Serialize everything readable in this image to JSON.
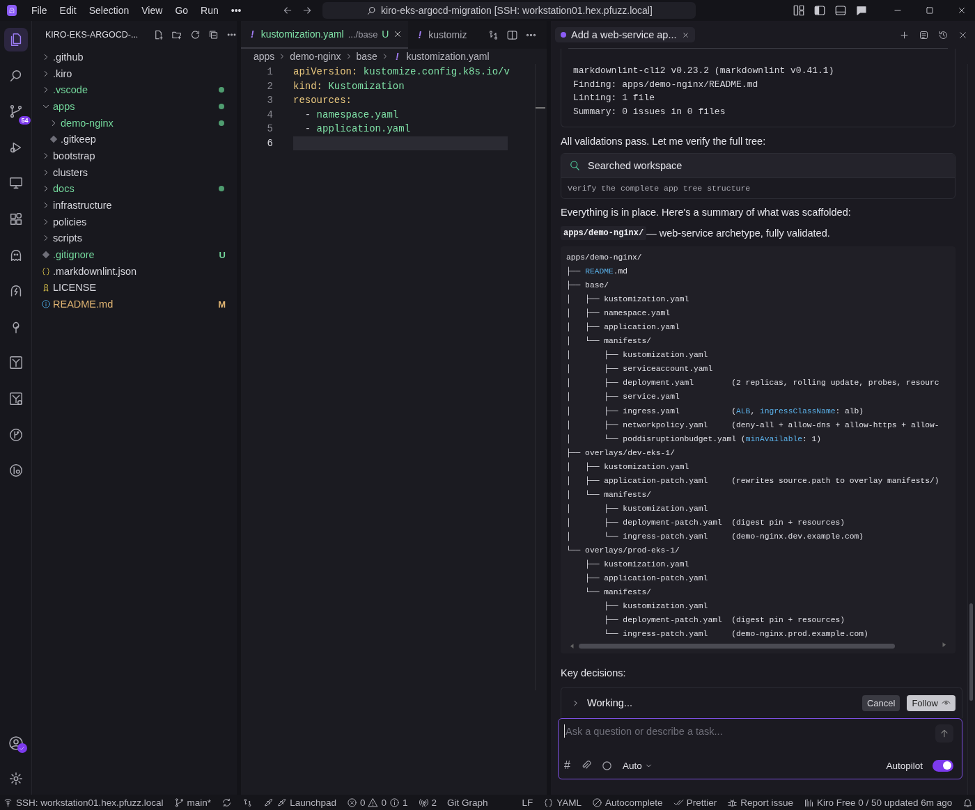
{
  "title_bar": {
    "menu": [
      "File",
      "Edit",
      "Selection",
      "View",
      "Go",
      "Run",
      "•••"
    ],
    "command_center": "kiro-eks-argocd-migration [SSH: workstation01.hex.pfuzz.local]"
  },
  "activity_bar": {
    "items": [
      {
        "selected": true
      },
      {
        "selected": false
      },
      {
        "selected": false,
        "badge": "54"
      },
      {
        "selected": false
      },
      {
        "selected": false
      },
      {
        "selected": false
      },
      {
        "selected": false
      },
      {
        "selected": false
      },
      {
        "selected": false
      },
      {
        "selected": false
      },
      {
        "selected": false
      },
      {
        "selected": false
      },
      {
        "selected": false
      }
    ]
  },
  "explorer": {
    "title": "KIRO-EKS-ARGOCD-...",
    "items": [
      {
        "name": ".github",
        "kind": "folder",
        "expanded": false,
        "color": "#d6d6dc",
        "dot": false
      },
      {
        "name": ".kiro",
        "kind": "folder",
        "expanded": false,
        "color": "#d6d6dc",
        "dot": false
      },
      {
        "name": ".vscode",
        "kind": "folder",
        "expanded": false,
        "color": "#73d69b",
        "dot": true
      },
      {
        "name": "apps",
        "kind": "folder",
        "expanded": true,
        "color": "#73d69b",
        "dot": true,
        "children": [
          {
            "name": "demo-nginx",
            "kind": "folder",
            "expanded": false,
            "color": "#73d69b",
            "dot": true
          },
          {
            "name": ".gitkeep",
            "kind": "git",
            "color": "#d6d6dc",
            "dot": false
          }
        ]
      },
      {
        "name": "bootstrap",
        "kind": "folder",
        "expanded": false,
        "color": "#d6d6dc",
        "dot": false
      },
      {
        "name": "clusters",
        "kind": "folder",
        "expanded": false,
        "color": "#d6d6dc",
        "dot": false
      },
      {
        "name": "docs",
        "kind": "folder",
        "expanded": false,
        "color": "#73d69b",
        "dot": true
      },
      {
        "name": "infrastructure",
        "kind": "folder",
        "expanded": false,
        "color": "#d6d6dc",
        "dot": false
      },
      {
        "name": "policies",
        "kind": "folder",
        "expanded": false,
        "color": "#d6d6dc",
        "dot": false
      },
      {
        "name": "scripts",
        "kind": "folder",
        "expanded": false,
        "color": "#d6d6dc",
        "dot": false
      },
      {
        "name": ".gitignore",
        "kind": "git",
        "color": "#73d69b",
        "dot": false,
        "badge": "U"
      },
      {
        "name": ".markdownlint.json",
        "kind": "json",
        "color": "#d6d6dc",
        "dot": false
      },
      {
        "name": "LICENSE",
        "kind": "license",
        "color": "#d6d6dc",
        "dot": false
      },
      {
        "name": "README.md",
        "kind": "info",
        "color": "#e2b673",
        "dot": false,
        "badge": "M"
      }
    ]
  },
  "editor": {
    "tabs": [
      {
        "icon_text": "!",
        "label": "kustomization.yaml",
        "description": ".../base",
        "badge": "U",
        "selected": true
      },
      {
        "icon_text": "!",
        "label": "kustomiz",
        "selected": false
      }
    ],
    "breadcrumbs": [
      {
        "text": "apps"
      },
      {
        "text": "demo-nginx"
      },
      {
        "text": "base"
      },
      {
        "icon_text": "!",
        "text": "kustomization.yaml"
      }
    ],
    "lines": [
      {
        "number": "1",
        "current": false,
        "tokens": [
          {
            "text": "apiVersion:",
            "kind": "key"
          },
          {
            "text": " kustomize.config.k8s.io/v",
            "kind": "value"
          }
        ]
      },
      {
        "number": "2",
        "current": false,
        "tokens": [
          {
            "text": "kind:",
            "kind": "key"
          },
          {
            "text": " Kustomization",
            "kind": "value"
          }
        ]
      },
      {
        "number": "3",
        "current": false,
        "tokens": [
          {
            "text": "resources:",
            "kind": "key"
          }
        ]
      },
      {
        "number": "4",
        "current": false,
        "tokens": [
          {
            "text": "  - ",
            "kind": "plain"
          },
          {
            "text": "namespace.yaml",
            "kind": "value"
          }
        ]
      },
      {
        "number": "5",
        "current": false,
        "tokens": [
          {
            "text": "  - ",
            "kind": "plain"
          },
          {
            "text": "application.yaml",
            "kind": "value"
          }
        ]
      },
      {
        "number": "6",
        "current": true
      }
    ]
  },
  "chat": {
    "tab": "Add a web-service ap...",
    "output": [
      "markdownlint-cli2 v0.23.2 (markdownlint v0.41.1)",
      "Finding: apps/demo-nginx/README.md",
      "Linting: 1 file",
      "Summary: 0 issues in 0 files"
    ],
    "message_1": "All validations pass. Let me verify the full tree:",
    "search_card": {
      "title": "Searched workspace",
      "detail": "Verify the complete app tree structure"
    },
    "message_2": "Everything is in place. Here's a summary of what was scaffolded:",
    "summary": {
      "code": "apps/demo-nginx/",
      "text": " — web-service archetype, fully validated."
    },
    "tree": [
      {
        "parts": [
          {
            "text": "apps/demo-nginx/",
            "highlight": false
          }
        ]
      },
      {
        "parts": [
          {
            "text": "├── ",
            "highlight": false
          },
          {
            "text": "README",
            "highlight": true
          },
          {
            "text": ".md",
            "highlight": false
          }
        ]
      },
      {
        "parts": [
          {
            "text": "├── base/",
            "highlight": false
          }
        ]
      },
      {
        "parts": [
          {
            "text": "│   ├── kustomization.yaml",
            "highlight": false
          }
        ]
      },
      {
        "parts": [
          {
            "text": "│   ├── namespace.yaml",
            "highlight": false
          }
        ]
      },
      {
        "parts": [
          {
            "text": "│   ├── application.yaml",
            "highlight": false
          }
        ]
      },
      {
        "parts": [
          {
            "text": "│   └── manifests/",
            "highlight": false
          }
        ]
      },
      {
        "parts": [
          {
            "text": "│       ├── kustomization.yaml",
            "highlight": false
          }
        ]
      },
      {
        "parts": [
          {
            "text": "│       ├── serviceaccount.yaml",
            "highlight": false
          }
        ]
      },
      {
        "parts": [
          {
            "text": "│       ├── deployment.yaml        (2 replicas, rolling update, probes, resourc",
            "highlight": false
          }
        ]
      },
      {
        "parts": [
          {
            "text": "│       ├── service.yaml",
            "highlight": false
          }
        ]
      },
      {
        "parts": [
          {
            "text": "│       ├── ingress.yaml           (",
            "highlight": false
          },
          {
            "text": "ALB",
            "highlight": true
          },
          {
            "text": ", ",
            "highlight": false
          },
          {
            "text": "ingressClassName",
            "highlight": true
          },
          {
            "text": ": alb)",
            "highlight": false
          }
        ]
      },
      {
        "parts": [
          {
            "text": "│       ├── networkpolicy.yaml     (deny-all + allow-dns + allow-https + allow-",
            "highlight": false
          }
        ]
      },
      {
        "parts": [
          {
            "text": "│       └── poddisruptionbudget.yaml (",
            "highlight": false
          },
          {
            "text": "minAvailable",
            "highlight": true
          },
          {
            "text": ": 1)",
            "highlight": false
          }
        ]
      },
      {
        "parts": [
          {
            "text": "├── overlays/dev-eks-1/",
            "highlight": false
          }
        ]
      },
      {
        "parts": [
          {
            "text": "│   ├── kustomization.yaml",
            "highlight": false
          }
        ]
      },
      {
        "parts": [
          {
            "text": "│   ├── application-patch.yaml     (rewrites source.path to overlay manifests/)",
            "highlight": false
          }
        ]
      },
      {
        "parts": [
          {
            "text": "│   └── manifests/",
            "highlight": false
          }
        ]
      },
      {
        "parts": [
          {
            "text": "│       ├── kustomization.yaml",
            "highlight": false
          }
        ]
      },
      {
        "parts": [
          {
            "text": "│       ├── deployment-patch.yaml  (digest pin + resources)",
            "highlight": false
          }
        ]
      },
      {
        "parts": [
          {
            "text": "│       └── ingress-patch.yaml     (demo-nginx.dev.example.com)",
            "highlight": false
          }
        ]
      },
      {
        "parts": [
          {
            "text": "└── overlays/prod-eks-1/",
            "highlight": false
          }
        ]
      },
      {
        "parts": [
          {
            "text": "    ├── kustomization.yaml",
            "highlight": false
          }
        ]
      },
      {
        "parts": [
          {
            "text": "    ├── application-patch.yaml",
            "highlight": false
          }
        ]
      },
      {
        "parts": [
          {
            "text": "    └── manifests/",
            "highlight": false
          }
        ]
      },
      {
        "parts": [
          {
            "text": "        ├── kustomization.yaml",
            "highlight": false
          }
        ]
      },
      {
        "parts": [
          {
            "text": "        ├── deployment-patch.yaml  (digest pin + resources)",
            "highlight": false
          }
        ]
      },
      {
        "parts": [
          {
            "text": "        └── ingress-patch.yaml     (demo-nginx.prod.example.com)",
            "highlight": false
          }
        ]
      }
    ],
    "message_3": "Key decisions:",
    "working": {
      "label": "Working...",
      "cancel": "Cancel",
      "follow": "Follow"
    },
    "input": {
      "placeholder": "Ask a question or describe a task...",
      "context": "#",
      "model": "Auto",
      "autopilot_label": "Autopilot",
      "autopilot": true
    }
  },
  "status_bar": {
    "items": [
      {
        "kind": "remote",
        "text": "SSH: workstation01.hex.pfuzz.local"
      },
      {
        "kind": "branch",
        "text": "main*"
      },
      {
        "kind": "sync"
      },
      {
        "kind": "graph"
      },
      {
        "kind": "launchpad",
        "text": "Launchpad"
      },
      {
        "kind": "problems",
        "errors": "0",
        "warnings": "0",
        "infos": "1"
      },
      {
        "kind": "ports",
        "text": "2"
      },
      {
        "kind": "plain",
        "text": "Git Graph"
      },
      {
        "kind": "plain",
        "text": "LF"
      },
      {
        "kind": "language",
        "text": "YAML"
      },
      {
        "kind": "autocomplete",
        "text": "Autocomplete"
      },
      {
        "kind": "prettier",
        "text": "Prettier"
      },
      {
        "kind": "bug",
        "text": "Report issue"
      },
      {
        "kind": "usage",
        "text": "Kiro Free 0 / 50 updated 6m ago"
      },
      {
        "kind": "bell"
      }
    ]
  }
}
